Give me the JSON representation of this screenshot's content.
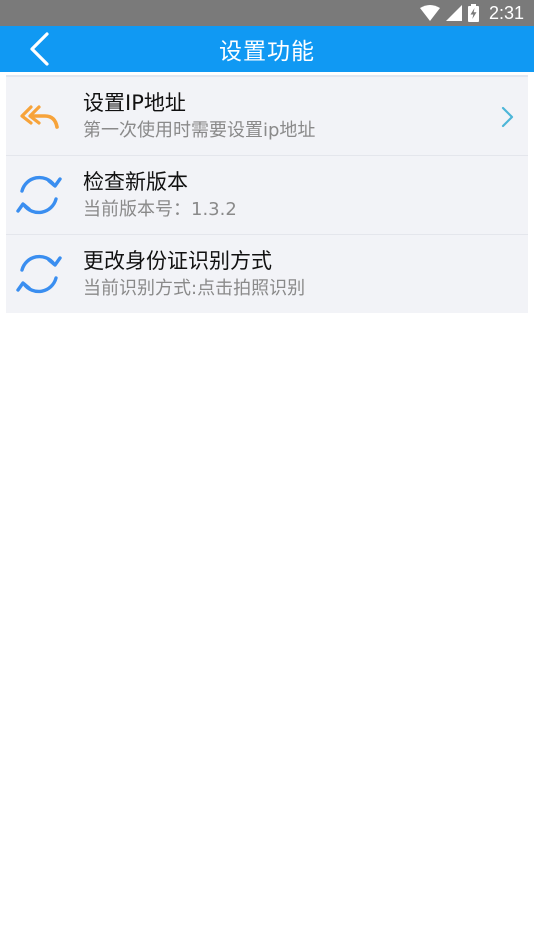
{
  "status_bar": {
    "time": "2:31",
    "icons": [
      "wifi-icon",
      "signal-icon",
      "battery-charging-icon"
    ]
  },
  "app_bar": {
    "title": "设置功能",
    "back_icon": "chevron-left-icon",
    "color": "#1099f3"
  },
  "settings": {
    "items": [
      {
        "title": "设置IP地址",
        "subtitle": "第一次使用时需要设置ip地址",
        "icon": "reply-all-icon",
        "icon_color": "#f7a33a",
        "has_chevron": true
      },
      {
        "title": "检查新版本",
        "subtitle": "当前版本号：1.3.2",
        "icon": "refresh-icon",
        "icon_color": "#3a8ef0",
        "has_chevron": false
      },
      {
        "title": "更改身份证识别方式",
        "subtitle": "当前识别方式:点击拍照识别",
        "icon": "refresh-icon",
        "icon_color": "#3a8ef0",
        "has_chevron": false
      }
    ]
  }
}
